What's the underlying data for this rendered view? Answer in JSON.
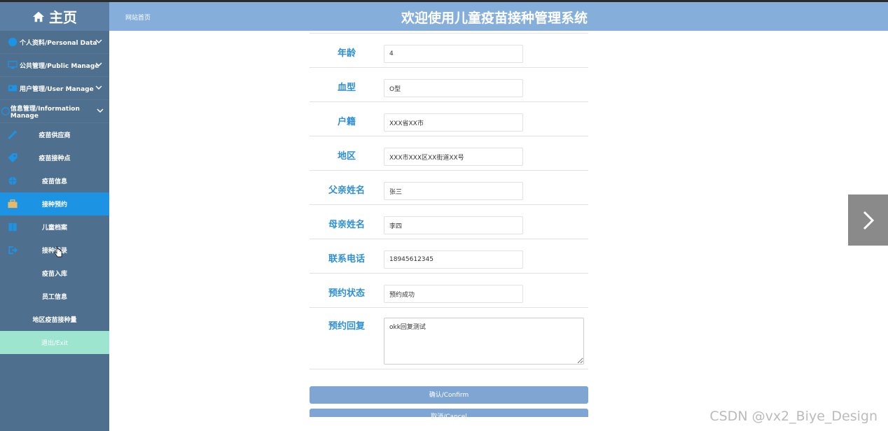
{
  "sidebar": {
    "home_label": "主页",
    "groups": [
      {
        "label": "个人资料/Personal Data"
      },
      {
        "label": "公共管理/Public Manage"
      },
      {
        "label": "用户管理/User Manage"
      },
      {
        "label": "信息管理/Information Manage"
      }
    ],
    "items": [
      {
        "label": "疫苗供应商"
      },
      {
        "label": "疫苗接种点"
      },
      {
        "label": "疫苗信息"
      },
      {
        "label": "接种预约"
      },
      {
        "label": "儿童档案"
      },
      {
        "label": "接种记录"
      },
      {
        "label": "疫苗入库"
      },
      {
        "label": "员工信息"
      },
      {
        "label": "地区疫苗接种量"
      }
    ],
    "exit_label": "退出/Exit"
  },
  "header": {
    "breadcrumb": "网站首页",
    "title": "欢迎使用儿童疫苗接种管理系统"
  },
  "form": {
    "fields": [
      {
        "label": "年龄",
        "value": "4"
      },
      {
        "label": "血型",
        "value": "O型"
      },
      {
        "label": "户籍",
        "value": "XXX省XX市"
      },
      {
        "label": "地区",
        "value": "XXX市XXX区XX街道XX号"
      },
      {
        "label": "父亲姓名",
        "value": "张三"
      },
      {
        "label": "母亲姓名",
        "value": "李四"
      },
      {
        "label": "联系电话",
        "value": "18945612345"
      },
      {
        "label": "预约状态",
        "value": "预约成功"
      }
    ],
    "reply_label": "预约回复",
    "reply_value": "okk回复测试",
    "confirm_label": "确认/Confirm",
    "cancel_label": "取消/Cancel"
  },
  "watermark": "CSDN @vx2_Biye_Design",
  "colors": {
    "sidebar": "#4f6f8f",
    "header": "#85aedb",
    "active": "#1d93e4",
    "exit": "#9ee5cf",
    "label": "#2f8fd6",
    "button": "#7fa6d2"
  }
}
